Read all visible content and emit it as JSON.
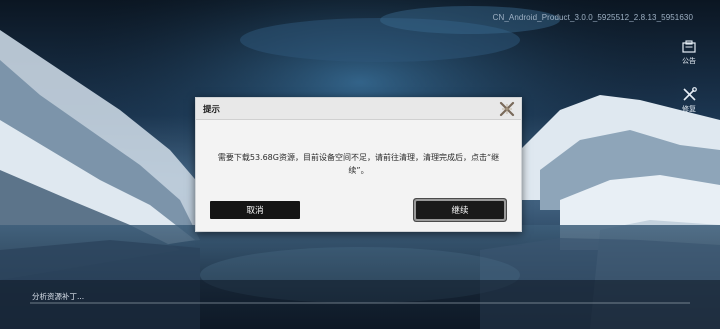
{
  "version_text": "CN_Android_Product_3.0.0_5925512_2.8.13_5951630",
  "side_buttons": {
    "announcement": {
      "label": "公告",
      "icon": "notice-board-icon"
    },
    "repair": {
      "label": "修复",
      "icon": "wrench-screwdriver-icon"
    }
  },
  "dialog": {
    "title": "提示",
    "close_icon": "close-x-icon",
    "message": "需要下载53.68G资源，目前设备空间不足，请前往清理，清理完成后，点击“继续”。",
    "cancel_label": "取消",
    "continue_label": "继续"
  },
  "status": {
    "text": "分析资源补丁...",
    "progress": 0
  },
  "colors": {
    "dialog_bg": "#f3f3f3",
    "button_bg": "#151515",
    "sky_top": "#0e1c2c",
    "snow": "#dfe8f0"
  }
}
